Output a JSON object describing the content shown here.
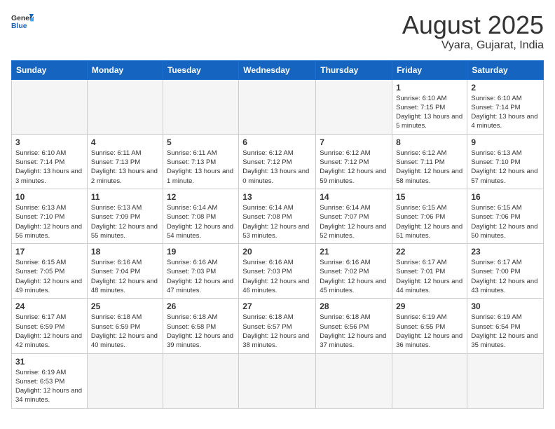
{
  "header": {
    "logo_general": "General",
    "logo_blue": "Blue",
    "month_title": "August 2025",
    "location": "Vyara, Gujarat, India"
  },
  "days_of_week": [
    "Sunday",
    "Monday",
    "Tuesday",
    "Wednesday",
    "Thursday",
    "Friday",
    "Saturday"
  ],
  "weeks": [
    [
      {
        "day": "",
        "info": ""
      },
      {
        "day": "",
        "info": ""
      },
      {
        "day": "",
        "info": ""
      },
      {
        "day": "",
        "info": ""
      },
      {
        "day": "",
        "info": ""
      },
      {
        "day": "1",
        "info": "Sunrise: 6:10 AM\nSunset: 7:15 PM\nDaylight: 13 hours and 5 minutes."
      },
      {
        "day": "2",
        "info": "Sunrise: 6:10 AM\nSunset: 7:14 PM\nDaylight: 13 hours and 4 minutes."
      }
    ],
    [
      {
        "day": "3",
        "info": "Sunrise: 6:10 AM\nSunset: 7:14 PM\nDaylight: 13 hours and 3 minutes."
      },
      {
        "day": "4",
        "info": "Sunrise: 6:11 AM\nSunset: 7:13 PM\nDaylight: 13 hours and 2 minutes."
      },
      {
        "day": "5",
        "info": "Sunrise: 6:11 AM\nSunset: 7:13 PM\nDaylight: 13 hours and 1 minute."
      },
      {
        "day": "6",
        "info": "Sunrise: 6:12 AM\nSunset: 7:12 PM\nDaylight: 13 hours and 0 minutes."
      },
      {
        "day": "7",
        "info": "Sunrise: 6:12 AM\nSunset: 7:12 PM\nDaylight: 12 hours and 59 minutes."
      },
      {
        "day": "8",
        "info": "Sunrise: 6:12 AM\nSunset: 7:11 PM\nDaylight: 12 hours and 58 minutes."
      },
      {
        "day": "9",
        "info": "Sunrise: 6:13 AM\nSunset: 7:10 PM\nDaylight: 12 hours and 57 minutes."
      }
    ],
    [
      {
        "day": "10",
        "info": "Sunrise: 6:13 AM\nSunset: 7:10 PM\nDaylight: 12 hours and 56 minutes."
      },
      {
        "day": "11",
        "info": "Sunrise: 6:13 AM\nSunset: 7:09 PM\nDaylight: 12 hours and 55 minutes."
      },
      {
        "day": "12",
        "info": "Sunrise: 6:14 AM\nSunset: 7:08 PM\nDaylight: 12 hours and 54 minutes."
      },
      {
        "day": "13",
        "info": "Sunrise: 6:14 AM\nSunset: 7:08 PM\nDaylight: 12 hours and 53 minutes."
      },
      {
        "day": "14",
        "info": "Sunrise: 6:14 AM\nSunset: 7:07 PM\nDaylight: 12 hours and 52 minutes."
      },
      {
        "day": "15",
        "info": "Sunrise: 6:15 AM\nSunset: 7:06 PM\nDaylight: 12 hours and 51 minutes."
      },
      {
        "day": "16",
        "info": "Sunrise: 6:15 AM\nSunset: 7:06 PM\nDaylight: 12 hours and 50 minutes."
      }
    ],
    [
      {
        "day": "17",
        "info": "Sunrise: 6:15 AM\nSunset: 7:05 PM\nDaylight: 12 hours and 49 minutes."
      },
      {
        "day": "18",
        "info": "Sunrise: 6:16 AM\nSunset: 7:04 PM\nDaylight: 12 hours and 48 minutes."
      },
      {
        "day": "19",
        "info": "Sunrise: 6:16 AM\nSunset: 7:03 PM\nDaylight: 12 hours and 47 minutes."
      },
      {
        "day": "20",
        "info": "Sunrise: 6:16 AM\nSunset: 7:03 PM\nDaylight: 12 hours and 46 minutes."
      },
      {
        "day": "21",
        "info": "Sunrise: 6:16 AM\nSunset: 7:02 PM\nDaylight: 12 hours and 45 minutes."
      },
      {
        "day": "22",
        "info": "Sunrise: 6:17 AM\nSunset: 7:01 PM\nDaylight: 12 hours and 44 minutes."
      },
      {
        "day": "23",
        "info": "Sunrise: 6:17 AM\nSunset: 7:00 PM\nDaylight: 12 hours and 43 minutes."
      }
    ],
    [
      {
        "day": "24",
        "info": "Sunrise: 6:17 AM\nSunset: 6:59 PM\nDaylight: 12 hours and 42 minutes."
      },
      {
        "day": "25",
        "info": "Sunrise: 6:18 AM\nSunset: 6:59 PM\nDaylight: 12 hours and 40 minutes."
      },
      {
        "day": "26",
        "info": "Sunrise: 6:18 AM\nSunset: 6:58 PM\nDaylight: 12 hours and 39 minutes."
      },
      {
        "day": "27",
        "info": "Sunrise: 6:18 AM\nSunset: 6:57 PM\nDaylight: 12 hours and 38 minutes."
      },
      {
        "day": "28",
        "info": "Sunrise: 6:18 AM\nSunset: 6:56 PM\nDaylight: 12 hours and 37 minutes."
      },
      {
        "day": "29",
        "info": "Sunrise: 6:19 AM\nSunset: 6:55 PM\nDaylight: 12 hours and 36 minutes."
      },
      {
        "day": "30",
        "info": "Sunrise: 6:19 AM\nSunset: 6:54 PM\nDaylight: 12 hours and 35 minutes."
      }
    ],
    [
      {
        "day": "31",
        "info": "Sunrise: 6:19 AM\nSunset: 6:53 PM\nDaylight: 12 hours and 34 minutes."
      },
      {
        "day": "",
        "info": ""
      },
      {
        "day": "",
        "info": ""
      },
      {
        "day": "",
        "info": ""
      },
      {
        "day": "",
        "info": ""
      },
      {
        "day": "",
        "info": ""
      },
      {
        "day": "",
        "info": ""
      }
    ]
  ]
}
